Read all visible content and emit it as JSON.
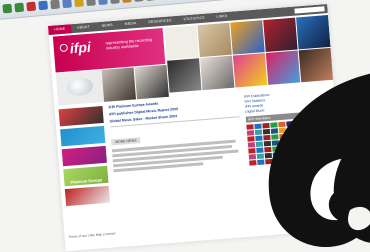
{
  "toolbar": {
    "icons": [
      "back-icon",
      "forward-icon",
      "stop-icon",
      "refresh-icon",
      "home-icon",
      "search-icon",
      "favorites-icon",
      "history-icon",
      "mail-icon",
      "print-icon",
      "edit-icon",
      "discuss-icon",
      "messenger-icon",
      "media-icon"
    ]
  },
  "nav": {
    "items": [
      "Home",
      "About",
      "News",
      "Media",
      "Resources",
      "Statistics",
      "Links"
    ]
  },
  "banner": {
    "logo": "ifpi",
    "tagline": "representing the recording industry worldwide"
  },
  "news": {
    "headlines": [
      "IFPI Platinum Europe Awards",
      "IFPI publishes Digital Music Report 2005",
      "Global Music Sales - Market Share 2004"
    ],
    "more_label": "MORE NEWS"
  },
  "sidebar_right": {
    "links": [
      "IFPI Publications",
      "IFPI Statistics",
      "IFPI Awards",
      "Digital Music"
    ],
    "logos_heading": "IFPI Members"
  },
  "leftcol": {
    "boxes": [
      "",
      "",
      "",
      "Platinum Europe",
      ""
    ]
  },
  "footer": {
    "lines": [
      "Terms of use | Site Map | Contact"
    ]
  },
  "colors": {
    "accent": "#c4004e",
    "nav_bg": "#5a5a5a",
    "link": "#1a3d8f"
  }
}
